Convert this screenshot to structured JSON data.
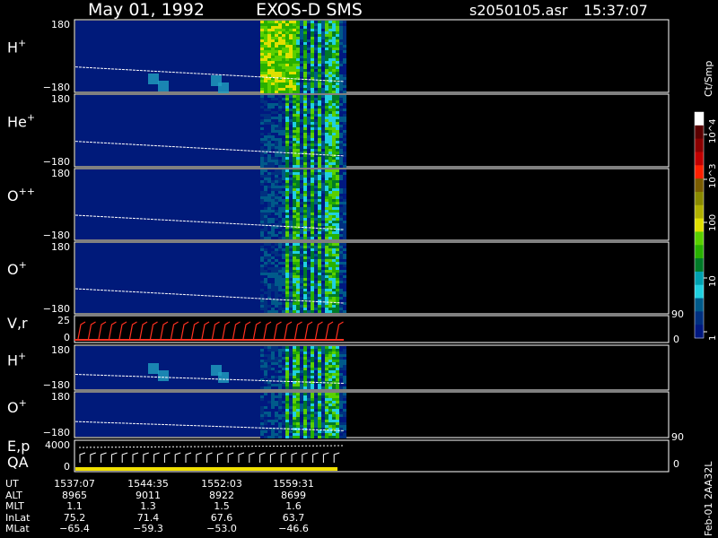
{
  "title": {
    "date": "May 01, 1992",
    "instrument": "EXOS-D SMS",
    "file": "s2050105.asr",
    "time": "15:37:07"
  },
  "colorbar": {
    "unit": "Ct/Smp",
    "tick_labels": [
      "10^4",
      "10^3",
      "100",
      "10",
      "1"
    ],
    "colors": [
      "#ffffff",
      "#5a0000",
      "#8a0000",
      "#c00000",
      "#ff2000",
      "#7a5c00",
      "#8a8a00",
      "#b0b000",
      "#e0e000",
      "#5ad000",
      "#28b000",
      "#007a28",
      "#00a0b0",
      "#20d0e0",
      "#005a8a",
      "#003080",
      "#001880"
    ]
  },
  "side_labels": {
    "vr_right_top": "90",
    "vr_right_bottom": "0",
    "ep_right_top": "90",
    "ep_right_bottom": "0",
    "id_code": "Feb-01 2AA32L"
  },
  "chart_data": {
    "type": "heatmap",
    "description_panels": [
      {
        "name": "H+",
        "label_main": "H",
        "label_sup": "+",
        "ytop": "180",
        "ybot": "−180"
      },
      {
        "name": "He+",
        "label_main": "He",
        "label_sup": "+",
        "ytop": "180",
        "ybot": "−180"
      },
      {
        "name": "O++",
        "label_main": "O",
        "label_sup": "++",
        "ytop": "180",
        "ybot": "−180"
      },
      {
        "name": "O+",
        "label_main": "O",
        "label_sup": "+",
        "ytop": "180",
        "ybot": "−180"
      },
      {
        "name": "V,r",
        "label_main": "V,r",
        "label_sup": "",
        "ytop": "25",
        "ybot": "0"
      },
      {
        "name": "H+ (2)",
        "label_main": "H",
        "label_sup": "+",
        "ytop": "180",
        "ybot": "−180"
      },
      {
        "name": "O+ (2)",
        "label_main": "O",
        "label_sup": "+",
        "ytop": "180",
        "ybot": "−180"
      },
      {
        "name": "E,p QA",
        "label_main": "E,p",
        "label_sup": "",
        "label_sub": "QA",
        "ytop": "4000",
        "ybot": "0"
      }
    ],
    "x_ticks": [
      {
        "ut": "1537:07",
        "alt": "8965",
        "mlt": "1.1",
        "inlat": "75.2",
        "mlat": "−65.4"
      },
      {
        "ut": "1544:35",
        "alt": "9011",
        "mlt": "1.3",
        "inlat": "71.4",
        "mlat": "−59.3"
      },
      {
        "ut": "1552:03",
        "alt": "8922",
        "mlt": "1.5",
        "inlat": "67.6",
        "mlat": "−53.0"
      },
      {
        "ut": "1559:31",
        "alt": "8699",
        "mlt": "1.6",
        "inlat": "63.7",
        "mlat": "−46.6"
      }
    ],
    "row_labels": [
      "UT",
      "ALT",
      "MLT",
      "InLat",
      "MLat"
    ]
  }
}
